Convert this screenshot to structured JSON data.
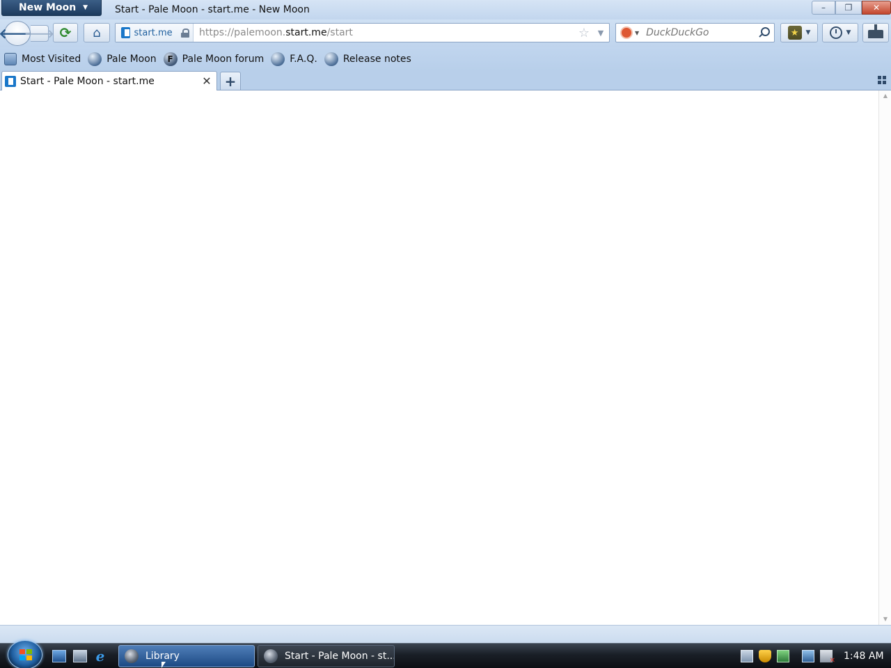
{
  "window": {
    "app_menu_label": "New Moon",
    "title": "Start - Pale Moon - start.me - New Moon",
    "controls": {
      "minimize": "–",
      "maximize": "❐",
      "close": "✕"
    }
  },
  "navbar": {
    "back_glyph": "🡐",
    "forward_glyph": "🡒",
    "reload_glyph": "⟳",
    "home_glyph": "⌂",
    "identity_label": "start.me",
    "url": {
      "prefix": "https://palemoon.",
      "host": "start.me",
      "path": "/start"
    },
    "bookmark_star_glyph": "☆",
    "url_dropdown_glyph": "▼",
    "search": {
      "engine": "duckduckgo-icon",
      "placeholder": "DuckDuckGo",
      "caret": "▼"
    },
    "bookmarks_star_glyph": "★",
    "caret": "▼"
  },
  "bookmarks_toolbar": {
    "items": [
      {
        "label": "Most Visited",
        "icon": "most-visited-icon"
      },
      {
        "label": "Pale Moon",
        "icon": "globe-icon"
      },
      {
        "label": "Pale Moon forum",
        "icon": "forum-icon",
        "icon_letter": "F"
      },
      {
        "label": "F.A.Q.",
        "icon": "globe-icon"
      },
      {
        "label": "Release notes",
        "icon": "globe-icon"
      }
    ]
  },
  "tabs": {
    "items": [
      {
        "label": "Start - Pale Moon - start.me",
        "selected": true
      }
    ],
    "close_glyph": "✕",
    "new_tab_glyph": "+"
  },
  "scrollbar": {
    "up_glyph": "▲",
    "down_glyph": "▼"
  },
  "taskbar": {
    "buttons": [
      {
        "label": "Library",
        "active": true
      },
      {
        "label": "Start - Pale Moon - st...",
        "active": false
      }
    ],
    "clock": "1:48 AM"
  },
  "colors": {
    "chrome_blue": "#c0d5ee",
    "app_menu": "#1c3a5e",
    "close_button": "#c3452c",
    "taskbar": "#1a1f27"
  }
}
